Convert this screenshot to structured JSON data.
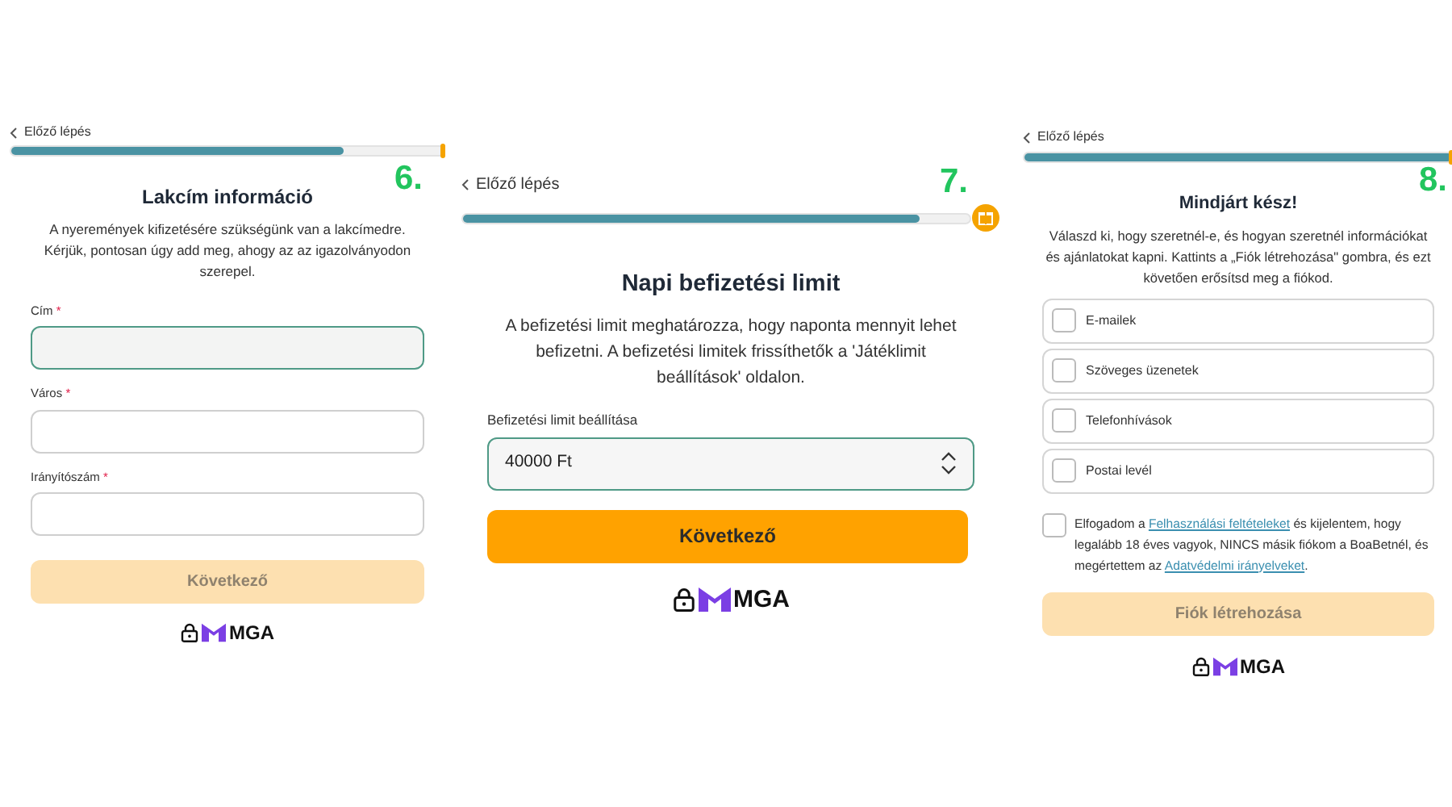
{
  "panels": [
    {
      "kind": "address",
      "back": "Előző lépés",
      "progress": {
        "level": 0.77
      },
      "step_label": "6.",
      "title": "Lakcím információ",
      "description": "A nyeremények kifizetésére szükségünk van a lakcímedre. Kérjük, pontosan úgy add meg, ahogy az az igazolványodon szerepel.",
      "fields": [
        {
          "label": "Cím",
          "required_mark": "*",
          "focused": true
        },
        {
          "label": "Város",
          "required_mark": "*",
          "focused": false
        },
        {
          "label": "Irányítószám",
          "required_mark": "*",
          "focused": false
        }
      ],
      "button": {
        "label": "Következő",
        "disabled": true
      },
      "logo": "MGA"
    },
    {
      "kind": "limit",
      "back": "Előző lépés",
      "progress": {
        "level": 0.9
      },
      "step_label": "7.",
      "title": "Napi befizetési limit",
      "description": "A befizetési limit meghatározza, hogy naponta mennyit lehet befizetni. A befizetési limitek frissíthetők a 'Játéklimit beállítások' oldalon.",
      "select": {
        "label": "Befizetési limit beállítása",
        "value": "40000 Ft"
      },
      "button": {
        "label": "Következő",
        "disabled": false
      },
      "logo": "MGA"
    },
    {
      "kind": "consent",
      "back": "Előző lépés",
      "progress": {
        "level": 1
      },
      "step_label": "8.",
      "title": "Mindjárt kész!",
      "description": "Válaszd ki, hogy szeretnél-e, és hogyan szeretnél információkat és ajánlatokat kapni. Kattints a „Fiók létrehozása\" gombra, és ezt követően erősítsd meg a fiókod.",
      "options": [
        {
          "label": "E-mailek",
          "checked": false
        },
        {
          "label": "Szöveges üzenetek",
          "checked": false
        },
        {
          "label": "Telefonhívások",
          "checked": false
        },
        {
          "label": "Postai levél",
          "checked": false
        }
      ],
      "consent": {
        "checked": false,
        "text_before": "Elfogadom a",
        "terms_link": "Felhasználási feltételeket",
        "text_middle": "és kijelentem, hogy legalább 18 éves vagyok, NINCS másik fiókom a BoaBetnél, és megértettem az",
        "privacy_link": "Adatvédelmi irányelveket",
        "text_after": "."
      },
      "button": {
        "label": "Fiók létrehozása",
        "disabled": true
      },
      "logo": "MGA"
    }
  ]
}
